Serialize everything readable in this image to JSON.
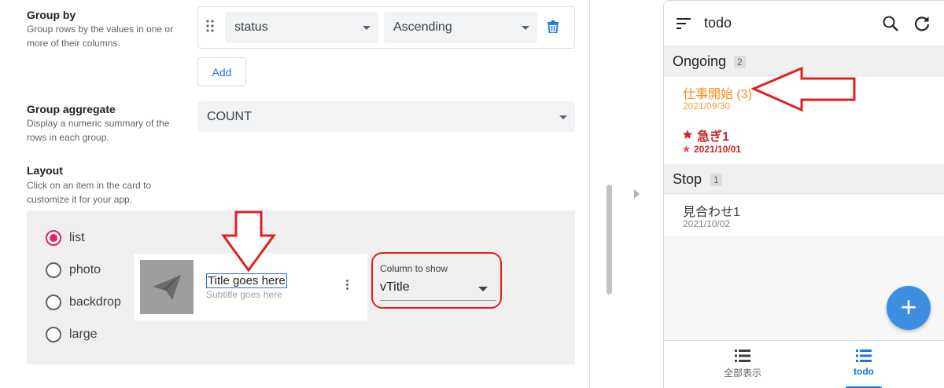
{
  "settings": {
    "group_by": {
      "title": "Group by",
      "description": "Group rows by the values in one or more of their columns.",
      "column_value": "status",
      "order_value": "Ascending",
      "add_label": "Add"
    },
    "group_aggregate": {
      "title": "Group aggregate",
      "description": "Display a numeric summary of the rows in each group.",
      "value": "COUNT"
    },
    "layout": {
      "title": "Layout",
      "description": "Click on an item in the card to customize it for your app.",
      "options": [
        {
          "label": "list",
          "selected": true
        },
        {
          "label": "photo",
          "selected": false
        },
        {
          "label": "backdrop",
          "selected": false
        },
        {
          "label": "large",
          "selected": false
        }
      ],
      "card": {
        "title": "Title goes here",
        "subtitle": "Subtitle goes here"
      },
      "column_to_show": {
        "label": "Column to show",
        "value": "vTitle"
      }
    }
  },
  "app": {
    "title": "todo",
    "groups": [
      {
        "name": "Ongoing",
        "count": "2",
        "items": [
          {
            "title": "仕事開始 (3)",
            "date": "2021/09/30",
            "starred": false,
            "color": "#f0901e"
          },
          {
            "title": "急ぎ1",
            "date": "2021/10/01",
            "starred": true,
            "color": "#c62828"
          }
        ]
      },
      {
        "name": "Stop",
        "count": "1",
        "items": [
          {
            "title": "見合わせ1",
            "date": "2021/10/02",
            "starred": false,
            "color": "#3c4043"
          }
        ]
      }
    ],
    "fab_symbol": "+",
    "nav": [
      {
        "label": "全部表示",
        "active": false,
        "icon": "list-icon"
      },
      {
        "label": "todo",
        "active": true,
        "icon": "list-icon"
      }
    ]
  },
  "colors": {
    "accent": "#1a73e8",
    "radio_selected": "#e91e63",
    "annotation_red": "#e02020",
    "ongoing_orange": "#f0901e",
    "urgent_red": "#c62828",
    "fab_blue": "#3d8ee0"
  }
}
